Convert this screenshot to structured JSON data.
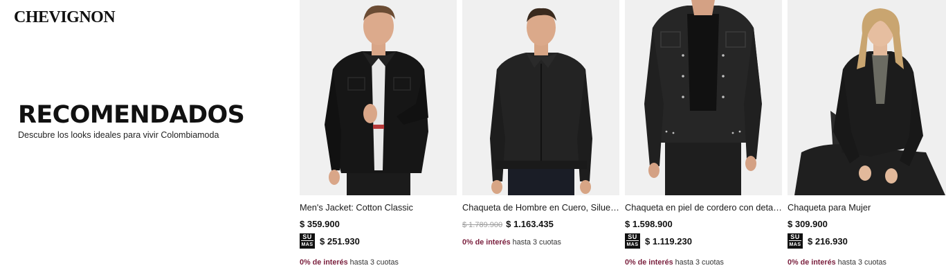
{
  "brand": {
    "logo_text": "CHEVIGNON"
  },
  "hero": {
    "title": "RECOMENDADOS",
    "subtitle": "Descubre los looks ideales para vivir Colombiamoda"
  },
  "products": [
    {
      "name": "Men's Jacket: Cotton Classic",
      "old_price": "",
      "price": "$ 359.900",
      "suma_price": "$ 251.930",
      "interest_pct": "0% de interés",
      "interest_rest": " hasta 3 cuotas",
      "image_icon": "man-denim-jacket-photo"
    },
    {
      "name": "Chaqueta de Hombre en Cuero, Silueta Regular",
      "old_price": "$ 1.789.900",
      "price": "$ 1.163.435",
      "suma_price": "",
      "interest_pct": "0% de interés",
      "interest_rest": " hasta 3 cuotas",
      "image_icon": "man-leather-jacket-photo"
    },
    {
      "name": "Chaqueta en piel de cordero con detalles",
      "old_price": "",
      "price": "$ 1.598.900",
      "suma_price": "$ 1.119.230",
      "interest_pct": "0% de interés",
      "interest_rest": " hasta 3 cuotas",
      "image_icon": "woman-studded-leather-jacket-photo"
    },
    {
      "name": "Chaqueta para Mujer",
      "old_price": "",
      "price": "$ 309.900",
      "suma_price": "$ 216.930",
      "interest_pct": "0% de interés",
      "interest_rest": " hasta 3 cuotas",
      "image_icon": "woman-black-jacket-photo"
    }
  ],
  "suma_badge": {
    "top": "SU",
    "bottom": "MAS"
  },
  "colors": {
    "interest_accent": "#7a1f3d",
    "image_bg": "#f1f1f1",
    "text": "#111111"
  }
}
